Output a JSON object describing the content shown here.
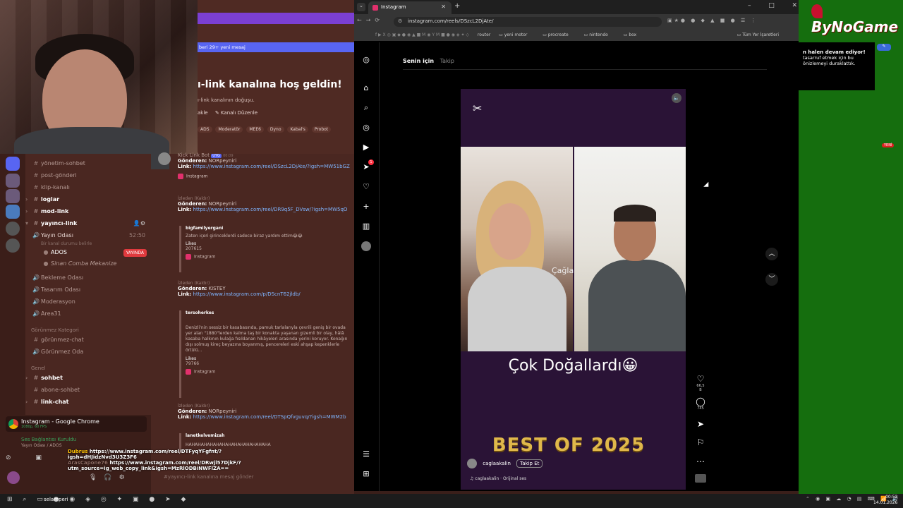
{
  "discord": {
    "new_messages_banner": "beri 29+ yeni mesaj",
    "welcome_title": "ı-link kanalına hoş geldin!",
    "welcome_sub": "ı-link kanalının doğuşu.",
    "actions": [
      "akle",
      "Kanalı Düzenle"
    ],
    "roles": [
      "ADS",
      "Moderatör",
      "MEE6",
      "Dyno",
      "Kabal's",
      "Probot"
    ],
    "channels": [
      {
        "label": "yönetim-sohbet",
        "icon": "hash"
      },
      {
        "label": "post-gönderi",
        "icon": "hash"
      },
      {
        "label": "klip-kanalı",
        "icon": "hash"
      },
      {
        "label": "loglar",
        "icon": "hash"
      },
      {
        "label": "mod-link",
        "icon": "hash"
      },
      {
        "label": "yayıncı-link",
        "icon": "hash"
      },
      {
        "label": "Yayın Odası",
        "icon": "speaker",
        "time": "52:50"
      },
      {
        "label": "Bir kanal durumu belirle",
        "icon": "none"
      },
      {
        "label": "ADOS",
        "icon": "avatar",
        "badge": "YAYINDA"
      },
      {
        "label": "Sinan Comba Mekanize",
        "icon": "avatar"
      },
      {
        "label": "Bekleme Odası",
        "icon": "speaker"
      },
      {
        "label": "Tasarım Odası",
        "icon": "speaker"
      },
      {
        "label": "Moderasyon",
        "icon": "speaker"
      },
      {
        "label": "Area31",
        "icon": "speaker"
      },
      {
        "label": "görünmez-chat",
        "icon": "hash"
      },
      {
        "label": "Görünmez Oda",
        "icon": "speaker"
      },
      {
        "label": "sohbet",
        "icon": "hash"
      },
      {
        "label": "abone-sohbet",
        "icon": "hash"
      },
      {
        "label": "link-chat",
        "icon": "hash"
      }
    ],
    "categories": [
      "Görünmez Kategori",
      "Genel"
    ],
    "messages": [
      {
        "author": "Kick Link Bot",
        "tag": "UYG",
        "time": "00:09",
        "sender_label": "Gönderen:",
        "sender": "NORpeyniri",
        "link_label": "Link:",
        "link": "https://www.instagram.com/reel/DSzcL2DjAte/?igsh=MW51bGZ"
      },
      {
        "removed": "İzleden (Kaldır)",
        "sender_label": "Gönderen:",
        "sender": "NORpeyniri",
        "link_label": "Link:",
        "link": "https://www.instagram.com/reel/DR9q5F_DVsw/?igsh=MW5qO",
        "embed_user": "bigfamilyergani",
        "embed_text": "Zaten içeri girinceklerdi sadece biraz yardım ettim😂😂",
        "likes_label": "Likes",
        "likes": "207615"
      },
      {
        "removed": "İzleden (Kaldır)",
        "sender_label": "Gönderen:",
        "sender": "KISTEY",
        "link_label": "Link:",
        "link": "https://www.instagram.com/p/DScnT62jldb/",
        "embed_user": "tersoherkes",
        "embed_text": "Denizli'nin sessiz bir kasabasında, pamuk tarlalarıyla çevrili geniş bir ovada yer alan \"1880\"lerden kalma taş bir konakta yaşanan gizemli bir olay, hâlâ kasaba halkının kulağa fısıldanan hikâyeleri arasında yerini koruyor. Konağın dışı solmuş kireç beyazına boyanmış, pencereleri eski ahşap kepenklerle örtülü...",
        "likes_label": "Likes",
        "likes": "79766"
      },
      {
        "removed": "İzleden (Kaldır)",
        "sender_label": "Gönderen:",
        "sender": "NORpeyniri",
        "link_label": "Link:",
        "link": "https://www.instagram.com/reel/DTSpQfvguvq/?igsh=MWM2b",
        "embed_user": "lanetkelvemizah",
        "embed_text": "HAHAHAHAHAHAHAHAHAHAHAHAHAHA"
      }
    ],
    "instagram_label": "Instagram",
    "stream_card": {
      "title": "Instagram - Google Chrome",
      "sub": "1080p, 60 FPS"
    },
    "voice": {
      "label": "Ses Bağlantısı Kuruldu",
      "sub": "Yayın Odası / ADOS"
    },
    "overlay_chat": [
      {
        "user": "Dubrus",
        "text": "https://www.instagram.com/reel/DTFyqYFgfnt/?igsh=dHJidzNvd3U3Z3F6"
      },
      {
        "user": "ArasCapone76",
        "text": "https://www.instagram.com/reel/DRwjl57DjkF/?utm_source=ig_web_copy_link&igsh=MzRlODBiNWFlZA=="
      }
    ],
    "input_placeholder": "#yayıncı-link kanalına mesaj gönder"
  },
  "chrome": {
    "tab_title": "Instagram",
    "url": "instagram.com/reels/DSzcL2DjAte/",
    "bookmarks": [
      "router",
      "yeni motor",
      "procreate",
      "nintendo",
      "box",
      "Tüm Yer İşaretleri"
    ]
  },
  "instagram": {
    "tabs": [
      "Senin için",
      "Takip"
    ],
    "reel": {
      "capcut_glyph": "✂",
      "overlay_name": "Çağla",
      "caption": "Çok Doğallardı😀",
      "banner": "BEST OF 2025",
      "username": "caglaakalin",
      "follow": "Takip Et",
      "audio": "♫ caglaakalin · Orijinal ses",
      "likes": "66,5 B",
      "comments": "745"
    },
    "notification_count": "1"
  },
  "right_panel": {
    "logo": "ByNoGame",
    "notice_title": "n halen devam ediyor!",
    "notice_body": "tasarruf etmek için bu önizlemeyi duraklattık.",
    "badge": "YENİ"
  },
  "taskbar": {
    "search_text": "selamperi",
    "time": "00:52",
    "date": "14.01.2026"
  }
}
